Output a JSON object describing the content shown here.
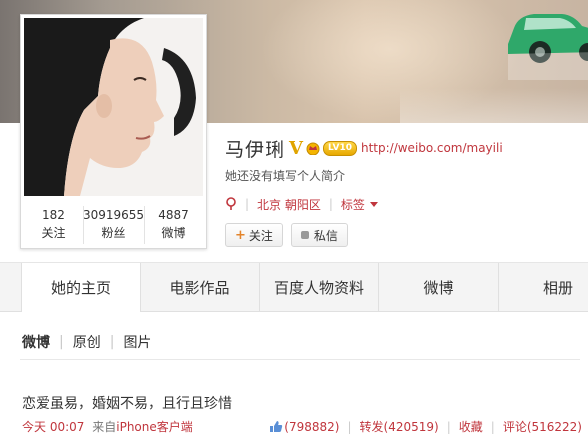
{
  "profile": {
    "name": "马伊琍",
    "verified": "V",
    "level": "LV10",
    "url": "http://weibo.com/mayili",
    "bio": "她还没有填写个人简介",
    "location": "北京 朝阳区",
    "tags_label": "标签",
    "stats": [
      {
        "num": "182",
        "label": "关注"
      },
      {
        "num": "30919655",
        "label": "粉丝"
      },
      {
        "num": "4887",
        "label": "微博"
      }
    ],
    "follow_label": "关注",
    "message_label": "私信"
  },
  "tabs": [
    "她的主页",
    "电影作品",
    "百度人物资料",
    "微博",
    "相册"
  ],
  "subnav": {
    "items": [
      "微博",
      "原创",
      "图片"
    ]
  },
  "post": {
    "text": "恋爱虽易，婚姻不易，且行且珍惜",
    "time": "今天 00:07",
    "from": "来自",
    "client": "iPhone客户端",
    "likes": "(798882)",
    "reposts": "转发(420519)",
    "favorite": "收藏",
    "comments": "评论(516222)"
  },
  "colors": {
    "accent": "#c0363d",
    "gold": "#e0a400"
  }
}
